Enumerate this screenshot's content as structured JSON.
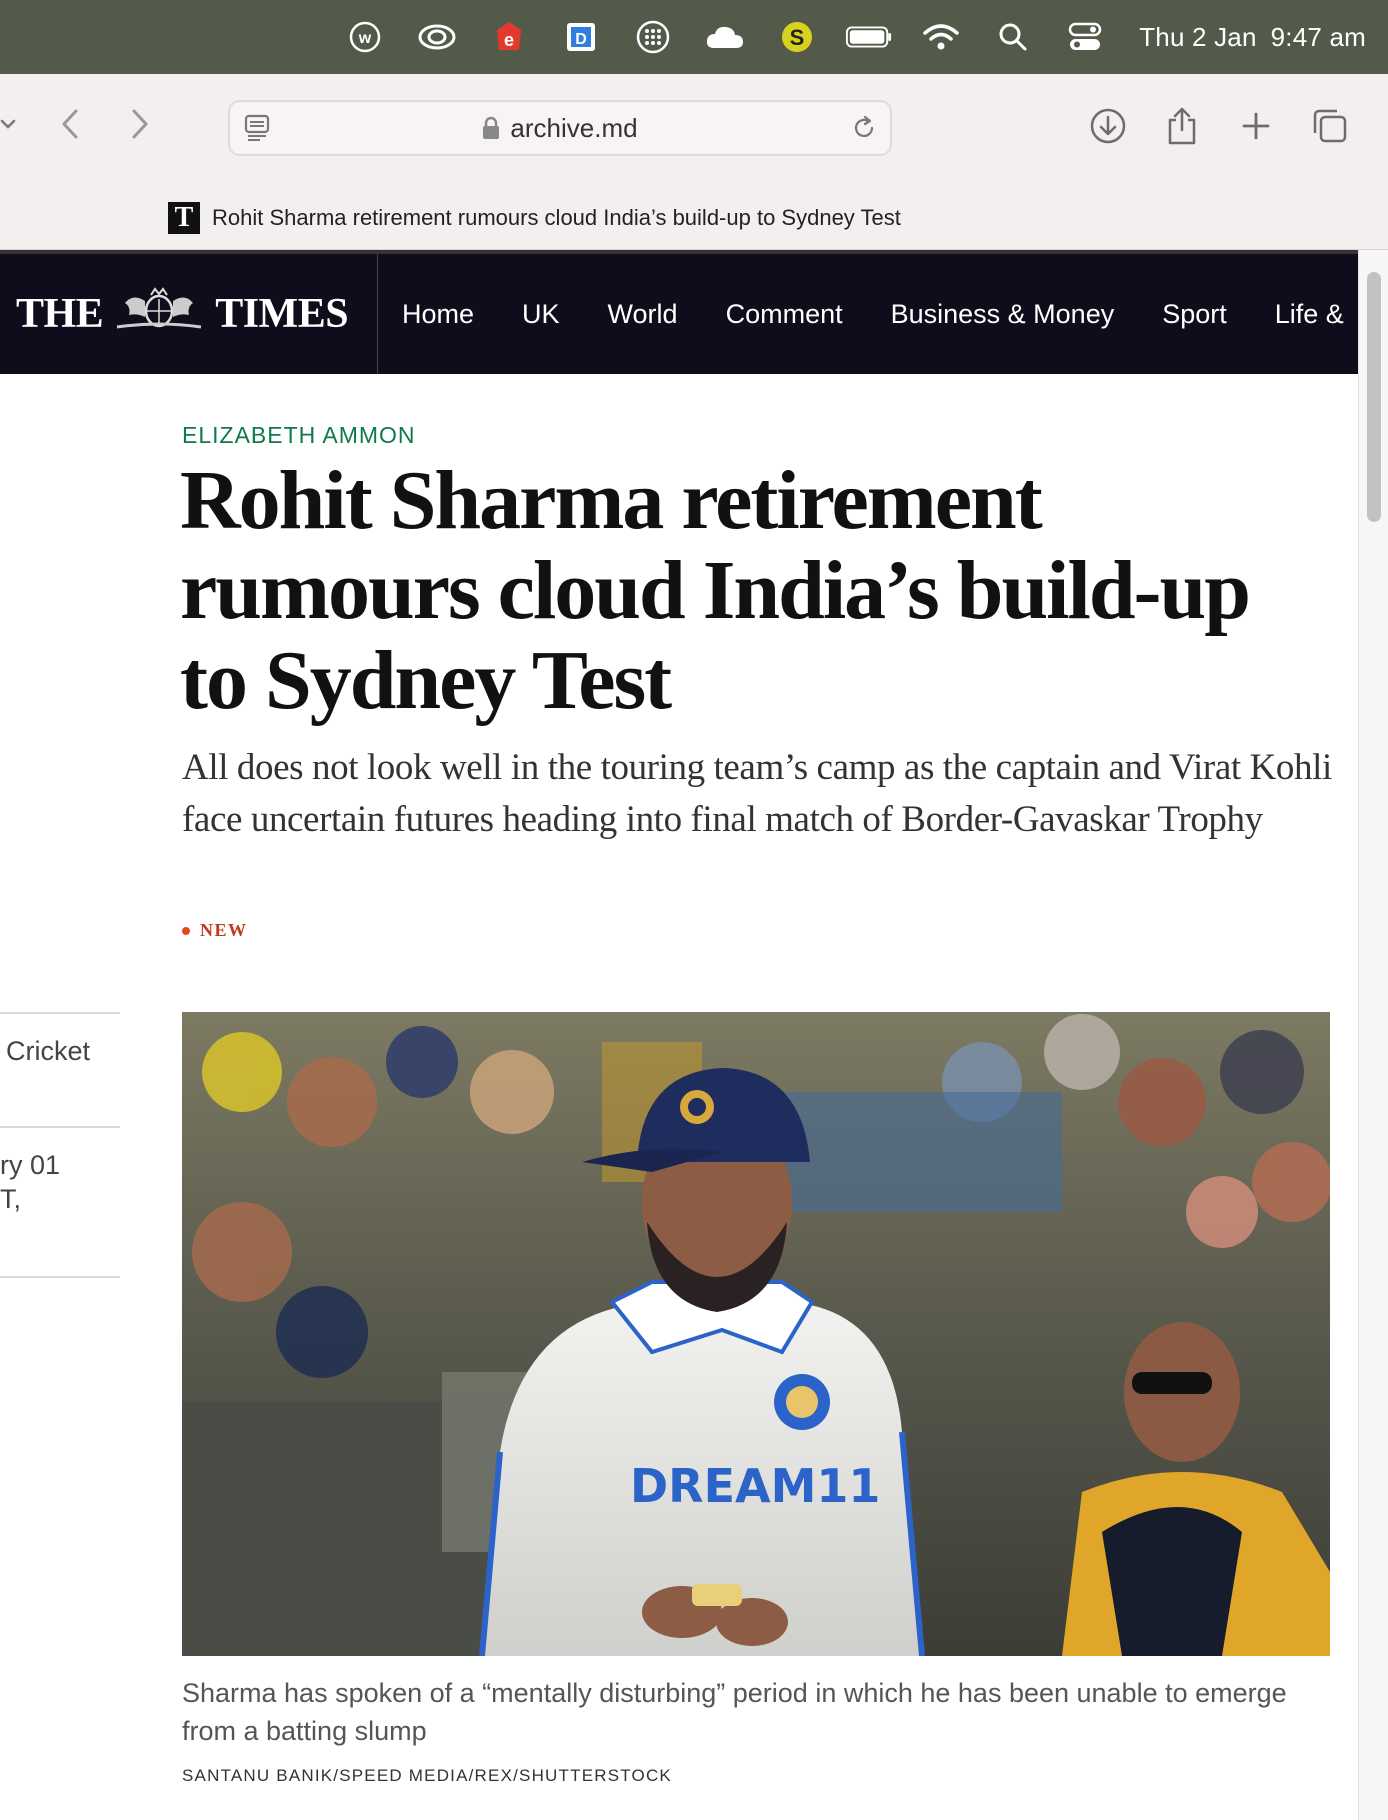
{
  "menubar": {
    "icons": [
      "w-circle-icon",
      "creative-cloud-icon",
      "e-app-icon",
      "d-app-icon",
      "grid-dots-icon",
      "cloud-icon",
      "s-app-icon",
      "battery-icon",
      "wifi-icon",
      "search-icon",
      "control-center-icon"
    ],
    "date": "Thu 2 Jan",
    "time": "9:47 am"
  },
  "browser": {
    "url": "archive.md",
    "tab_title": "Rohit Sharma retirement rumours cloud India’s build-up to Sydney Test",
    "favicon_letter": "T"
  },
  "times": {
    "logo_left": "THE",
    "logo_right": "TIMES",
    "nav": [
      "Home",
      "UK",
      "World",
      "Comment",
      "Business & Money",
      "Sport",
      "Life &"
    ]
  },
  "article": {
    "byline": "ELIZABETH AMMON",
    "headline": "Rohit Sharma retirement rumours cloud India’s build-up to Sydney Test",
    "standfirst": "All does not look well in the touring team’s camp as the captain and Virat Kohli face uncertain futures heading into final match of Border-Gavaskar Trophy",
    "badge": "NEW",
    "caption": "Sharma has spoken of a “mentally disturbing” period in which he has been unable to emerge from a batting slump",
    "credit": "SANTANU BANIK/SPEED MEDIA/REX/SHUTTERSTOCK"
  },
  "sidebar": {
    "section": "Cricket",
    "date_fragment": "ry 01",
    "time_fragment": "T,"
  },
  "colors": {
    "menubar": "#545a4a",
    "times_nav": "#0d0d1b",
    "byline": "#0f7a49",
    "new_badge": "#c0391a"
  }
}
